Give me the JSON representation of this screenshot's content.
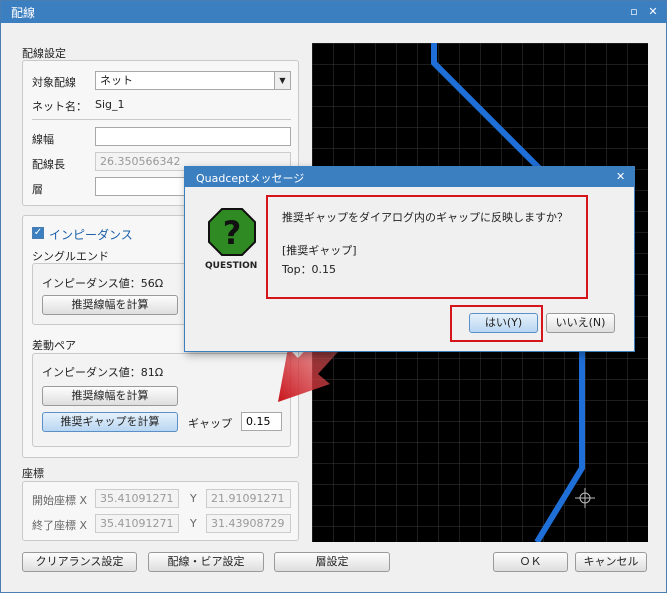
{
  "window": {
    "title": "配線",
    "restore_icon": "▫",
    "close_icon": "✕"
  },
  "routing_settings": {
    "group_label": "配線設定",
    "target_label": "対象配線",
    "target_value": "ネット",
    "net_name_label": "ネット名：",
    "net_name_value": "Sig_1",
    "width_label": "線幅",
    "width_value": "",
    "length_label": "配線長",
    "length_value": "26.350566342",
    "layer_label": "層",
    "layer_value": ""
  },
  "impedance": {
    "checkbox_label": "インピーダンス",
    "checked": true,
    "single_end_label": "シングルエンド",
    "single_impedance": "インピーダンス値：56Ω",
    "single_calc_button": "推奨線幅を計算",
    "diff_pair_label": "差動ペア",
    "diff_impedance": "インピーダンス値：81Ω",
    "diff_calc_width_button": "推奨線幅を計算",
    "diff_calc_gap_button": "推奨ギャップを計算",
    "gap_label": "ギャップ",
    "gap_value": "0.15"
  },
  "coordinates": {
    "group_label": "座標",
    "start_label": "開始座標 X",
    "start_x": "35.41091271",
    "start_y_label": "Y",
    "start_y": "21.91091271",
    "end_label": "終了座標 X",
    "end_x": "35.41091271",
    "end_y_label": "Y",
    "end_y": "31.43908729"
  },
  "footer": {
    "clearance_button": "クリアランス設定",
    "via_button": "配線・ビア設定",
    "layer_button": "層設定",
    "ok_button": "ＯＫ",
    "cancel_button": "キャンセル"
  },
  "dialog": {
    "title": "Quadceptメッセージ",
    "close_icon": "✕",
    "icon_label": "QUESTION",
    "icon_glyph": "?",
    "message_line1": "推奨ギャップをダイアログ内のギャップに反映しますか？",
    "message_line2": "[推奨ギャップ]",
    "message_line3": "Top：0.15",
    "yes_button": "はい(Y)",
    "no_button": "いいえ(N)"
  },
  "colors": {
    "accent": "#3c7fc1",
    "trace": "#1f6fd8",
    "highlight": "#d8141b",
    "grid": "#3a3a3a",
    "icon_green": "#2f8a23"
  }
}
